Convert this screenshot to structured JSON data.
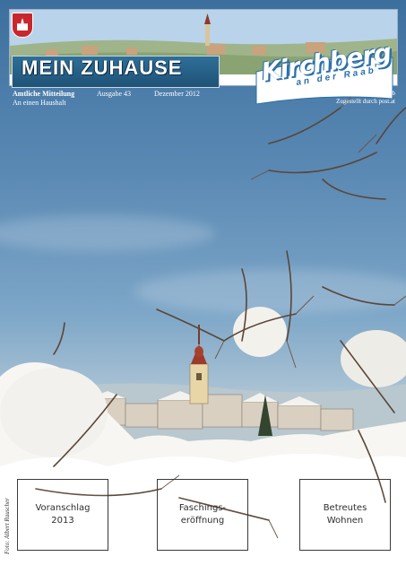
{
  "header": {
    "title": "MEIN ZUHAUSE",
    "logo_text": "Kirchberg",
    "logo_sub": "an der Raab"
  },
  "info": {
    "publication": "Amtliche Mitteilung",
    "recipient": "An einen Haushalt",
    "issue": "Ausgabe 43",
    "date": "Dezember 2012",
    "municipality": "Gemeinde Kirchberg an der Raab",
    "delivery": "Zugestellt durch post.at"
  },
  "credit": "Foto: Albert Rauscher",
  "boxes": [
    {
      "label": "Voranschlag\n2013"
    },
    {
      "label": "Faschings-\neröffnung"
    },
    {
      "label": "Betreutes\nWohnen"
    }
  ],
  "colors": {
    "title_box": "#1f5277",
    "logo_blue": "#2b6fa8",
    "crest_red": "#c8272d"
  }
}
